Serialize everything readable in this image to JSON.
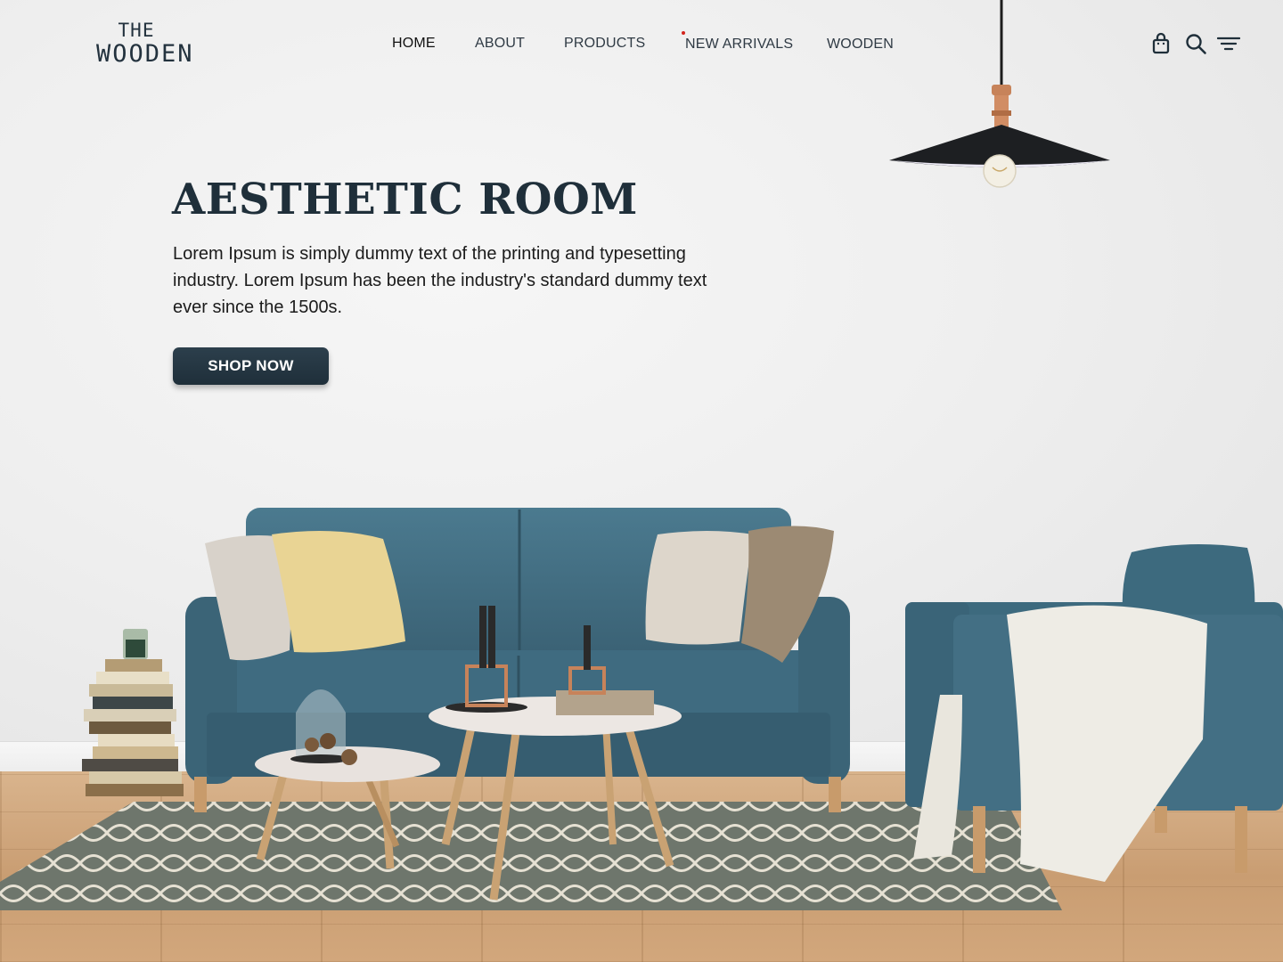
{
  "brand": {
    "line1": "THE",
    "line2": "WOODEN"
  },
  "nav": {
    "items": [
      {
        "label": "HOME",
        "active": true
      },
      {
        "label": "ABOUT",
        "active": false
      },
      {
        "label": "PRODUCTS",
        "active": false
      },
      {
        "label": "NEW ARRIVALS",
        "active": false
      },
      {
        "label": "WOODEN",
        "active": false
      }
    ]
  },
  "header_icons": [
    "shopping-bag-icon",
    "search-icon",
    "filter-menu-icon"
  ],
  "hero": {
    "title": "AESTHETIC ROOM",
    "description": "Lorem Ipsum is simply dummy text of the printing and typesetting industry. Lorem Ipsum has been the industry's standard dummy text ever since the 1500s.",
    "cta_label": "SHOP NOW"
  },
  "colors": {
    "primary": "#1f2f3a",
    "sofa": "#3f6b80",
    "accent_dot": "#d3241d",
    "floor": "#cfa277"
  }
}
